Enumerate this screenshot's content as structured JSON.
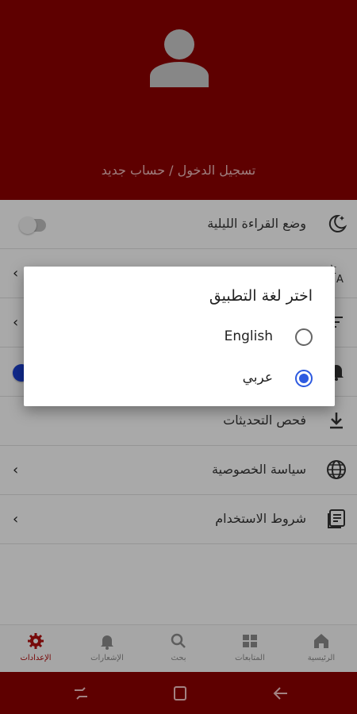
{
  "header": {
    "login_text": "تسجيل الدخول / حساب جديد"
  },
  "settings": {
    "rows": [
      {
        "label": "وضع القراءة الليلية",
        "icon": "night-mode-icon",
        "control": "toggle",
        "on": false
      },
      {
        "label": "",
        "icon": "translate-icon",
        "control": "chevron"
      },
      {
        "label": "",
        "icon": "text-size-icon",
        "control": "chevron"
      },
      {
        "label": "",
        "icon": "notifications-icon",
        "control": "toggle",
        "on": true
      },
      {
        "label": "فحص التحديثات",
        "icon": "download-icon",
        "control": "none"
      },
      {
        "label": "سياسة الخصوصية",
        "icon": "globe-icon",
        "control": "chevron"
      },
      {
        "label": "شروط الاستخدام",
        "icon": "document-icon",
        "control": "chevron"
      }
    ]
  },
  "dialog": {
    "title": "اختر لغة التطبيق",
    "options": [
      {
        "label": "English",
        "selected": false
      },
      {
        "label": "عربي",
        "selected": true
      }
    ]
  },
  "bottom_nav": {
    "items": [
      {
        "label": "الرئيسية",
        "icon": "home-icon"
      },
      {
        "label": "المتابعات",
        "icon": "grid-icon"
      },
      {
        "label": "بحث",
        "icon": "search-icon"
      },
      {
        "label": "الإشعارات",
        "icon": "bell-icon"
      },
      {
        "label": "الإعدادات",
        "icon": "gear-icon",
        "active": true
      }
    ]
  },
  "colors": {
    "primary": "#8b0000",
    "accent_blue": "#2d5ae0",
    "active_nav": "#b01010"
  }
}
